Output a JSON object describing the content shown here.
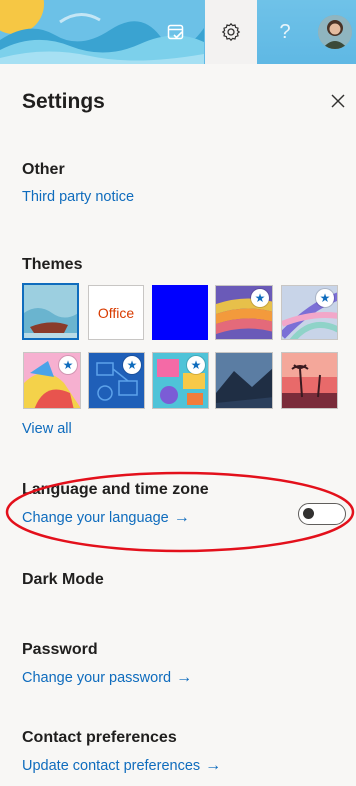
{
  "header": {
    "icons": [
      "day-calendar-check-icon",
      "gear-icon",
      "help-icon",
      "avatar"
    ],
    "help_glyph": "?"
  },
  "settings": {
    "title": "Settings",
    "other": {
      "heading": "Other",
      "link": "Third party notice"
    },
    "themes": {
      "heading": "Themes",
      "office_label": "Office",
      "view_all": "View all",
      "items": [
        "beach",
        "office",
        "blue",
        "rainbow",
        "abstract",
        "unicorn",
        "circuit",
        "carnival",
        "mountain",
        "palms"
      ]
    },
    "language": {
      "heading": "Language and time zone",
      "link": "Change your language",
      "arrow": "→"
    },
    "dark_mode": {
      "label": "Dark Mode",
      "enabled": false
    },
    "password": {
      "heading": "Password",
      "link": "Change your password",
      "arrow": "→"
    },
    "contact": {
      "heading": "Contact preferences",
      "link": "Update contact preferences",
      "arrow": "→"
    }
  },
  "colors": {
    "accent": "#0f6cbd",
    "annotation": "#e3101b",
    "header": "#5fb8e4"
  }
}
